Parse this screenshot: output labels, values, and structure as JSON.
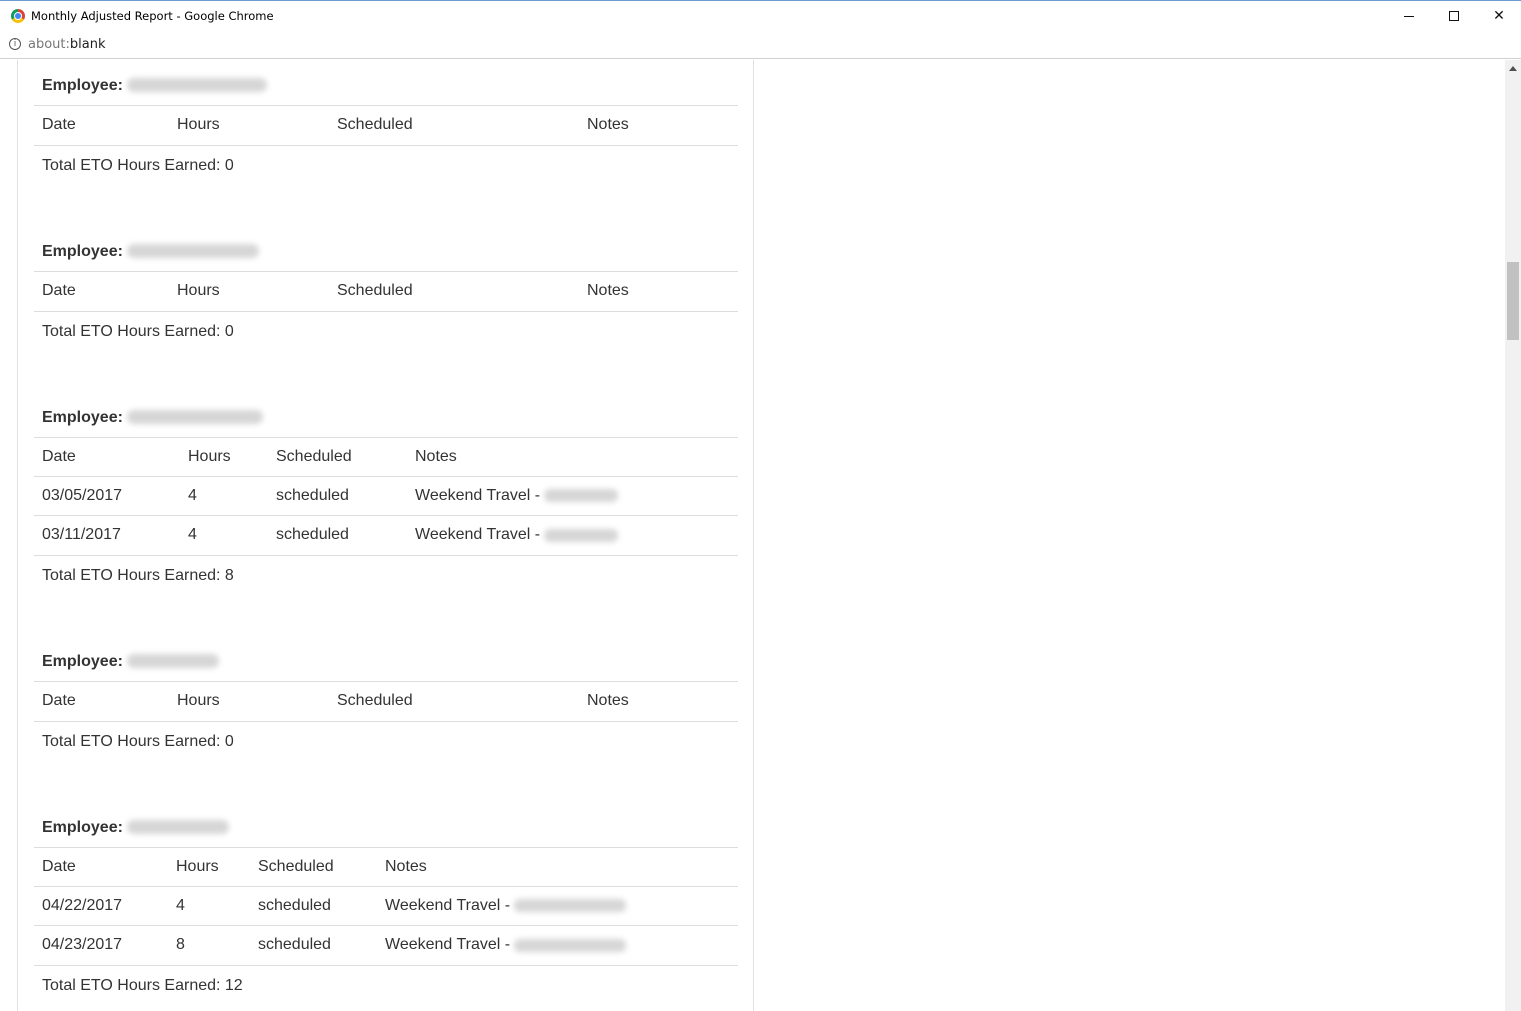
{
  "window": {
    "title": "Monthly Adjusted Report - Google Chrome",
    "url_scheme": "about:",
    "url_rest": "blank"
  },
  "report": {
    "employee_label": "Employee:",
    "columns": {
      "date": "Date",
      "hours": "Hours",
      "scheduled": "Scheduled",
      "notes": "Notes"
    },
    "total_label": "Total ETO Hours Earned:",
    "employees": [
      {
        "total": "0",
        "rows": []
      },
      {
        "total": "0",
        "rows": []
      },
      {
        "total": "8",
        "rows": [
          {
            "date": "03/05/2017",
            "hours": "4",
            "scheduled": "scheduled",
            "notes": "Weekend Travel -"
          },
          {
            "date": "03/11/2017",
            "hours": "4",
            "scheduled": "scheduled",
            "notes": "Weekend Travel -"
          }
        ]
      },
      {
        "total": "0",
        "rows": []
      },
      {
        "total": "12",
        "rows": [
          {
            "date": "04/22/2017",
            "hours": "4",
            "scheduled": "scheduled",
            "notes": "Weekend Travel -"
          },
          {
            "date": "04/23/2017",
            "hours": "8",
            "scheduled": "scheduled",
            "notes": "Weekend Travel -"
          }
        ]
      }
    ]
  }
}
